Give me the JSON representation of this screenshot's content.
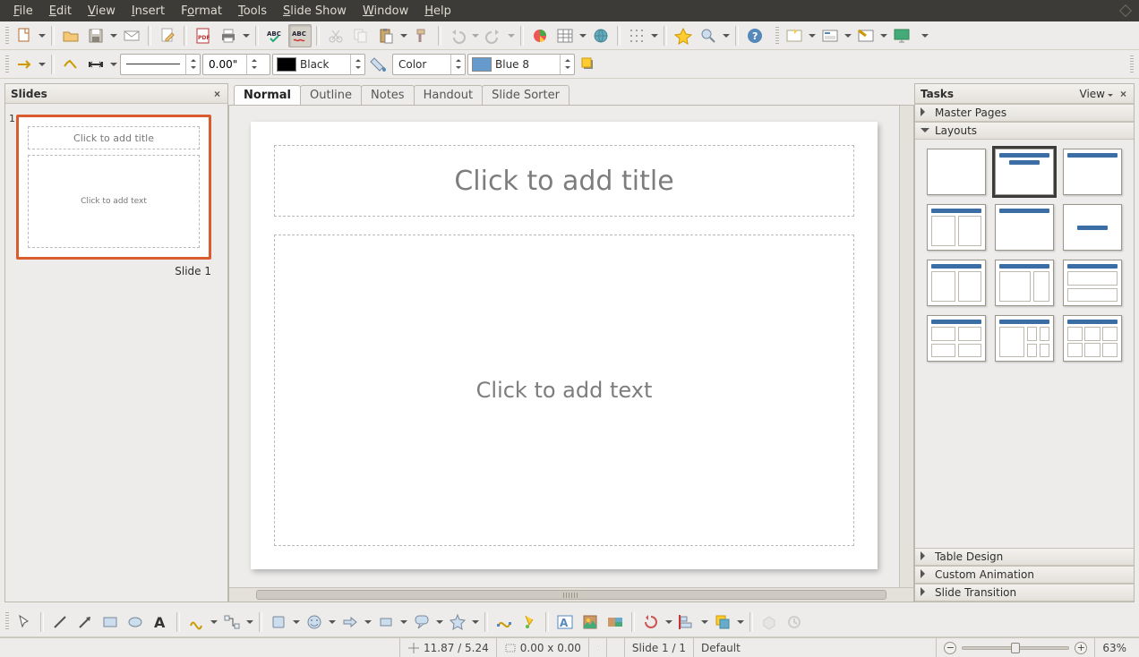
{
  "menu": {
    "file": "File",
    "edit": "Edit",
    "view": "View",
    "insert": "Insert",
    "format": "Format",
    "tools": "Tools",
    "slideshow": "Slide Show",
    "window": "Window",
    "help": "Help"
  },
  "toolbar2": {
    "line_width": "0.00\"",
    "line_color_label": "Black",
    "fill_type": "Color",
    "fill_color_label": "Blue 8"
  },
  "slides_panel": {
    "title": "Slides",
    "thumb_title": "Click to add title",
    "thumb_body": "Click to add text",
    "thumb_caption": "Slide 1",
    "index": "1"
  },
  "view_tabs": {
    "normal": "Normal",
    "outline": "Outline",
    "notes": "Notes",
    "handout": "Handout",
    "sorter": "Slide Sorter"
  },
  "canvas": {
    "title_placeholder": "Click to add title",
    "body_placeholder": "Click to add text"
  },
  "tasks_panel": {
    "title": "Tasks",
    "view": "View",
    "sections": {
      "master": "Master Pages",
      "layouts": "Layouts",
      "table": "Table Design",
      "anim": "Custom Animation",
      "trans": "Slide Transition"
    }
  },
  "status": {
    "pos": "11.87 / 5.24",
    "size": "0.00 x 0.00",
    "slide": "Slide 1 / 1",
    "style": "Default",
    "zoom": "63%"
  }
}
